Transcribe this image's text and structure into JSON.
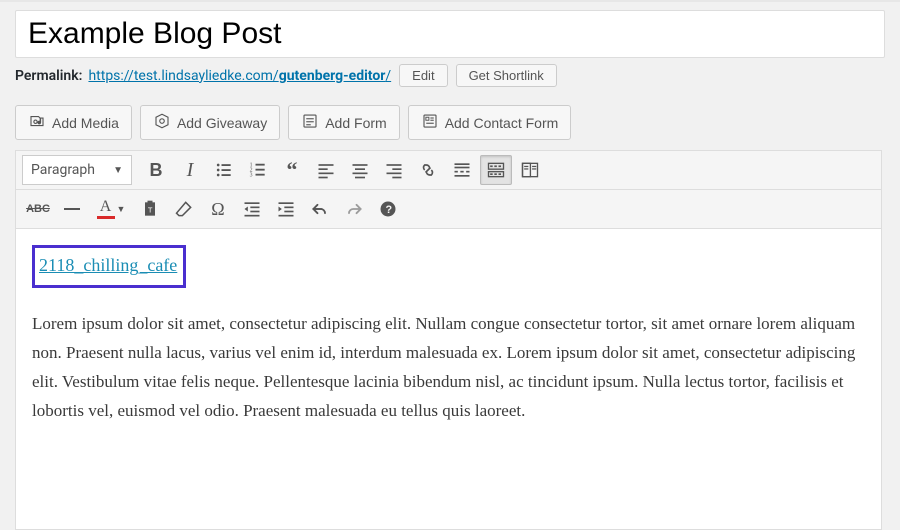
{
  "title": "Example Blog Post",
  "permalink": {
    "label": "Permalink:",
    "url_prefix": "https://test.lindsayliedke.com/",
    "url_slug": "gutenberg-editor",
    "url_suffix": "/",
    "edit_label": "Edit",
    "shortlink_label": "Get Shortlink"
  },
  "media_buttons": {
    "add_media": "Add Media",
    "add_giveaway": "Add Giveaway",
    "add_form": "Add Form",
    "add_contact_form": "Add Contact Form"
  },
  "toolbar": {
    "format_selected": "Paragraph"
  },
  "content": {
    "highlight_link_text": "2118_chilling_cafe",
    "paragraph": "Lorem ipsum dolor sit amet, consectetur adipiscing elit. Nullam congue consectetur tortor, sit amet ornare lorem aliquam non. Praesent nulla lacus, varius vel enim id, interdum malesuada ex. Lorem ipsum dolor sit amet, consectetur adipiscing elit. Vestibulum vitae felis neque. Pellentesque lacinia bibendum nisl, ac tincidunt ipsum. Nulla lectus tortor, facilisis et lobortis vel, euismod vel odio. Praesent malesuada eu tellus quis laoreet."
  }
}
